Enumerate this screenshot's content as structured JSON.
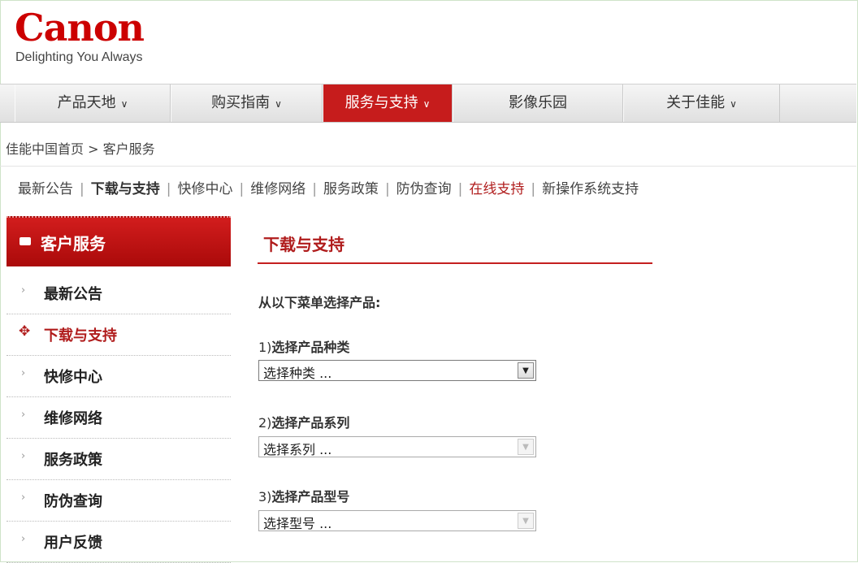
{
  "brand": {
    "logo_text": "Canon",
    "tagline": "Delighting You Always",
    "logo_color": "#cc0000"
  },
  "nav": [
    {
      "label": "产品天地",
      "chevron": "∨"
    },
    {
      "label": "购买指南",
      "chevron": "∨"
    },
    {
      "label": "服务与支持",
      "chevron": "∨"
    },
    {
      "label": "影像乐园",
      "chevron": ""
    },
    {
      "label": "关于佳能",
      "chevron": "∨"
    }
  ],
  "breadcrumb": "佳能中国首页 > 客户服务",
  "subnav": {
    "items": [
      "最新公告",
      "下载与支持",
      "快修中心",
      "维修网络",
      "服务政策",
      "防伪查询",
      "在线支持",
      "新操作系统支持"
    ],
    "separator": "|"
  },
  "sidebar": {
    "header": "客户服务",
    "header_icon": "mail-icon",
    "items": [
      {
        "label": "最新公告"
      },
      {
        "label": "下载与支持"
      },
      {
        "label": "快修中心"
      },
      {
        "label": "维修网络"
      },
      {
        "label": "服务政策"
      },
      {
        "label": "防伪查询"
      },
      {
        "label": "用户反馈"
      }
    ]
  },
  "main": {
    "title": "下载与支持",
    "intro": "从以下菜单选择产品:",
    "steps": [
      {
        "num": "1)",
        "label": "选择产品种类",
        "select_value": "选择种类 ..."
      },
      {
        "num": "2)",
        "label": "选择产品系列",
        "select_value": "选择系列 ..."
      },
      {
        "num": "3)",
        "label": "选择产品型号",
        "select_value": "选择型号 ..."
      }
    ]
  },
  "colors": {
    "accent_red": "#c61c1c",
    "link_red": "#b01c1c"
  }
}
